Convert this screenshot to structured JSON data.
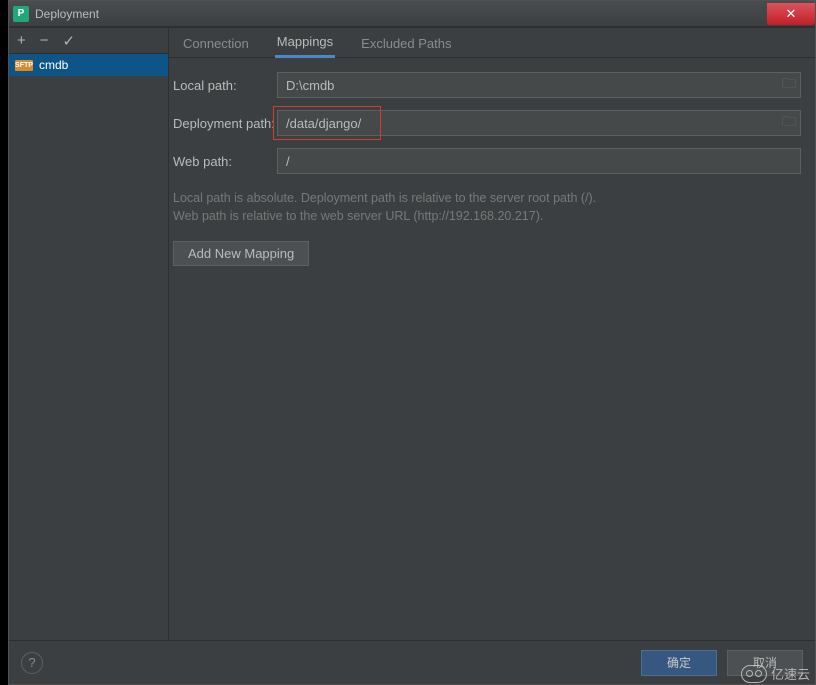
{
  "window": {
    "title": "Deployment"
  },
  "titlebar_icon_letter": "P",
  "sidebar": {
    "items": [
      {
        "badge": "SFTP",
        "name": "cmdb"
      }
    ]
  },
  "tabs": [
    {
      "label": "Connection",
      "active": false
    },
    {
      "label": "Mappings",
      "active": true
    },
    {
      "label": "Excluded Paths",
      "active": false
    }
  ],
  "form": {
    "local_path_label": "Local path:",
    "local_path_value": "D:\\cmdb",
    "deployment_path_label": "Deployment path:",
    "deployment_path_value": "/data/django/",
    "web_path_label": "Web path:",
    "web_path_value": "/"
  },
  "help_text_line1": "Local path is absolute. Deployment path is relative to the server root path (/).",
  "help_text_line2": "Web path is relative to the web server URL (http://192.168.20.217).",
  "add_button_label": "Add New Mapping",
  "footer": {
    "ok_label": "确定",
    "cancel_label": "取消"
  },
  "watermark": "亿速云"
}
